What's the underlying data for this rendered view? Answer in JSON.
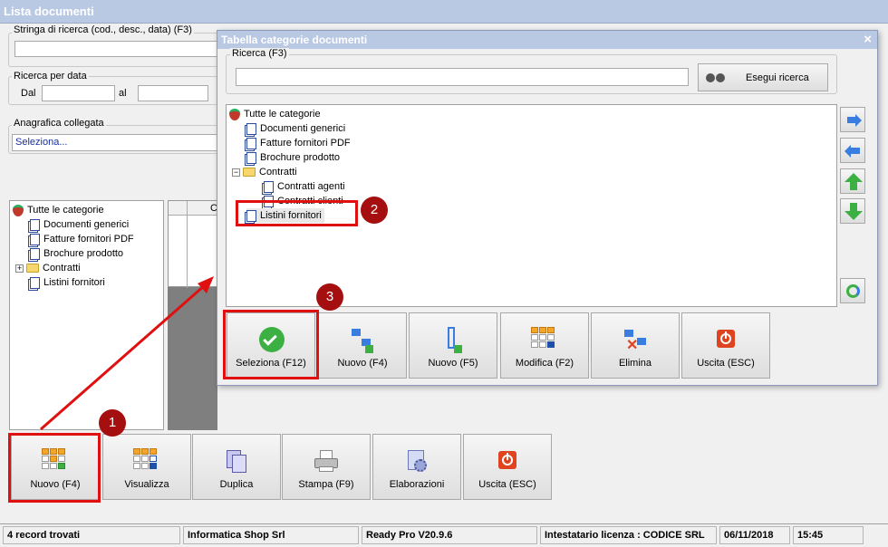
{
  "main_window": {
    "title": "Lista documenti",
    "search_label": "Stringa di ricerca (cod., desc., data) (F3)",
    "search_value": "",
    "date_group_label": "Ricerca per data",
    "date_from_label": "Dal",
    "date_to_label": "al",
    "anagrafica_label": "Anagrafica collegata",
    "anagrafica_value": "Seleziona...",
    "grid_header_fragment": "C",
    "tree": [
      {
        "label": "Tutte le categorie",
        "type": "root"
      },
      {
        "label": "Documenti generici",
        "type": "doc"
      },
      {
        "label": "Fatture fornitori PDF",
        "type": "doc"
      },
      {
        "label": "Brochure prodotto",
        "type": "doc"
      },
      {
        "label": "Contratti",
        "type": "folder",
        "expander": "+"
      },
      {
        "label": "Listini fornitori",
        "type": "doc"
      }
    ],
    "toolbar": [
      {
        "label": "Nuovo (F4)",
        "icon": "new-grid-icon"
      },
      {
        "label": "Visualizza",
        "icon": "view-grid-icon"
      },
      {
        "label": "Duplica",
        "icon": "duplicate-icon"
      },
      {
        "label": "Stampa (F9)",
        "icon": "printer-icon"
      },
      {
        "label": "Elaborazioni",
        "icon": "process-gear-icon"
      },
      {
        "label": "Uscita (ESC)",
        "icon": "exit-icon"
      }
    ]
  },
  "dialog": {
    "title": "Tabella categorie documenti",
    "close_glyph": "×",
    "search_label": "Ricerca (F3)",
    "search_value": "",
    "search_button": "Esegui ricerca",
    "tree": [
      {
        "label": "Tutte le categorie",
        "type": "root"
      },
      {
        "label": "Documenti generici",
        "type": "doc"
      },
      {
        "label": "Fatture fornitori PDF",
        "type": "doc"
      },
      {
        "label": "Brochure prodotto",
        "type": "doc"
      },
      {
        "label": "Contratti",
        "type": "folder",
        "expander": "−"
      },
      {
        "label": "Contratti agenti",
        "type": "doc"
      },
      {
        "label": "Contratti clienti",
        "type": "doc"
      },
      {
        "label": "Listini fornitori",
        "type": "doc",
        "selected": true
      }
    ],
    "side_buttons": [
      "arrow-right-icon",
      "arrow-left-icon",
      "arrow-up-icon",
      "arrow-down-icon",
      "refresh-icon"
    ],
    "toolbar": [
      {
        "label": "Seleziona (F12)",
        "icon": "check-icon"
      },
      {
        "label": "Nuovo (F4)",
        "icon": "new-node-icon"
      },
      {
        "label": "Nuovo (F5)",
        "icon": "new-child-node-icon"
      },
      {
        "label": "Modifica (F2)",
        "icon": "edit-grid-icon"
      },
      {
        "label": "Elimina",
        "icon": "delete-node-icon"
      },
      {
        "label": "Uscita (ESC)",
        "icon": "exit-icon"
      }
    ]
  },
  "annotations": {
    "badge1": "1",
    "badge2": "2",
    "badge3": "3",
    "color": "#e01010"
  },
  "statusbar": {
    "records": "4 record trovati",
    "company": "Informatica Shop Srl",
    "version": "Ready Pro V20.9.6",
    "license": "Intestatario licenza : CODICE SRL",
    "date": "06/11/2018",
    "time": "15:45"
  }
}
